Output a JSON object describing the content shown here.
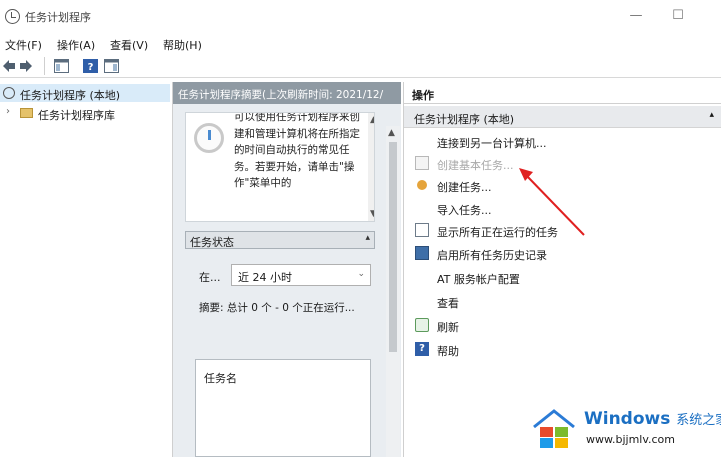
{
  "window": {
    "title": "任务计划程序",
    "minimize_glyph": "—",
    "maximize_glyph": "☐"
  },
  "menubar": {
    "items": [
      {
        "label": "文件(F)"
      },
      {
        "label": "操作(A)"
      },
      {
        "label": "查看(V)"
      },
      {
        "label": "帮助(H)"
      }
    ]
  },
  "tree": {
    "root_label": "任务计划程序 (本地)",
    "child_label": "任务计划程序库"
  },
  "center": {
    "header": "任务计划程序摘要(上次刷新时间: 2021/12/",
    "description": "可以使用任务计划程序来创建和管理计算机将在所指定的时间自动执行的常见任务。若要开始，请单击\"操作\"菜单中的",
    "section_label": "任务状态",
    "status_label": "在...",
    "status_value": "近 24 小时",
    "summary": "摘要: 总计 0 个 - 0 个正在运行...",
    "task_list_header": "任务名"
  },
  "actions": {
    "title": "操作",
    "group_label": "任务计划程序 (本地)",
    "items": [
      {
        "label": "连接到另一台计算机...",
        "icon": "none"
      },
      {
        "label": "创建基本任务...",
        "icon": "calendar-icon",
        "disabled": true
      },
      {
        "label": "创建任务...",
        "icon": "gear-icon"
      },
      {
        "label": "导入任务...",
        "icon": "none"
      },
      {
        "label": "显示所有正在运行的任务",
        "icon": "list-icon"
      },
      {
        "label": "启用所有任务历史记录",
        "icon": "log-icon"
      },
      {
        "label": "AT 服务帐户配置",
        "icon": "none"
      },
      {
        "label": "查看",
        "icon": "none"
      },
      {
        "label": "刷新",
        "icon": "refresh-icon"
      },
      {
        "label": "帮助",
        "icon": "help-icon"
      }
    ]
  },
  "watermark": {
    "brand": "Windows",
    "brand_cn": "系统之家",
    "url": "www.bjjmlv.com"
  },
  "colors": {
    "selection": "#d9ebf9",
    "center_header": "#8f9aa3",
    "annotation": "#e02020",
    "brand_blue": "#1b6fc2"
  }
}
